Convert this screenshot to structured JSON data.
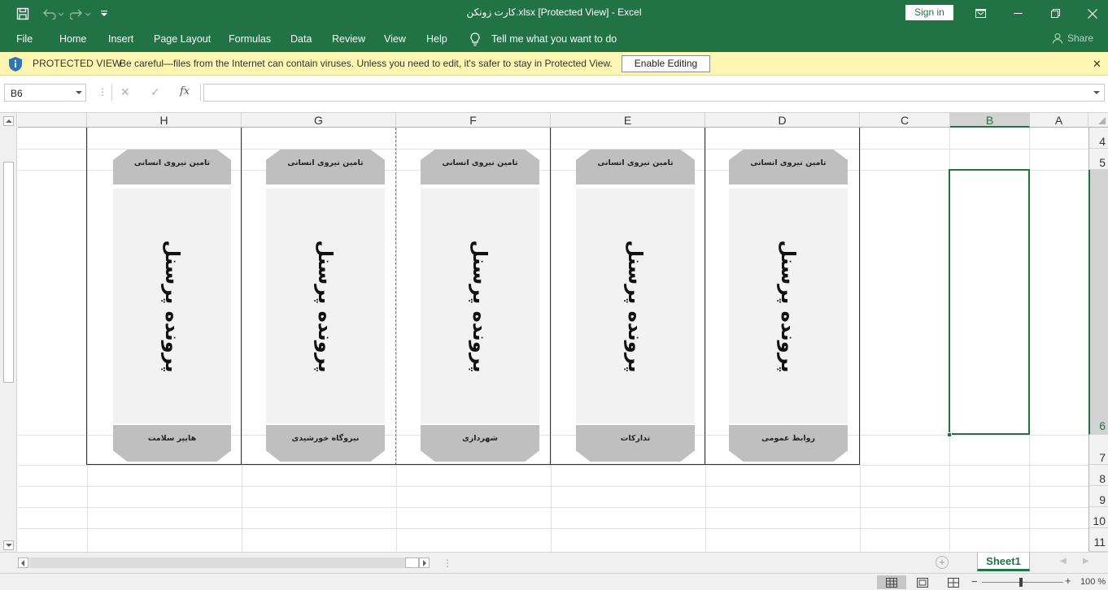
{
  "titlebar": {
    "title": "کارت زونکن.xlsx  [Protected View]  -  Excel",
    "signin_label": "Sign in",
    "accent": "#217346"
  },
  "ribbon": {
    "tabs": [
      "File",
      "Home",
      "Insert",
      "Page Layout",
      "Formulas",
      "Data",
      "Review",
      "View",
      "Help"
    ],
    "tell_me": "Tell me what you want to do",
    "share": "Share"
  },
  "protected_view": {
    "title": "PROTECTED VIEW",
    "message": "Be careful—files from the Internet can contain viruses. Unless you need to edit, it's safer to stay in Protected View.",
    "button": "Enable Editing",
    "bg": "#fdf6b3"
  },
  "formula_bar": {
    "name_box": "B6",
    "fx": "fx",
    "formula": ""
  },
  "grid": {
    "columns": [
      "H",
      "G",
      "F",
      "E",
      "D",
      "C",
      "B",
      "A"
    ],
    "active_column": "B",
    "rows": [
      "4",
      "5",
      "6",
      "7",
      "8",
      "9",
      "10",
      "11"
    ],
    "active_row": "6",
    "selected_cell": "B6"
  },
  "cards": [
    {
      "col": "H",
      "header": "تامین نیروی انسانی",
      "title": "پرونده پرسنل",
      "footer": "هایپر سلامت"
    },
    {
      "col": "G",
      "header": "تامین نیروی انسانی",
      "title": "پرونده پرسنل",
      "footer": "نیروگاه خورشیدی"
    },
    {
      "col": "F",
      "header": "تامین نیروی انسانی",
      "title": "پرونده پرسنل",
      "footer": "شهرداری"
    },
    {
      "col": "E",
      "header": "تامین نیروی انسانی",
      "title": "پرونده پرسنل",
      "footer": "تدارکات"
    },
    {
      "col": "D",
      "header": "تامین نیروی انسانی",
      "title": "پرونده پرسنل",
      "footer": "روابط عمومی"
    }
  ],
  "sheets": {
    "tabs": [
      "Sheet1"
    ],
    "active": "Sheet1"
  },
  "status": {
    "zoom": "100 %",
    "zoom_percent": 100
  }
}
